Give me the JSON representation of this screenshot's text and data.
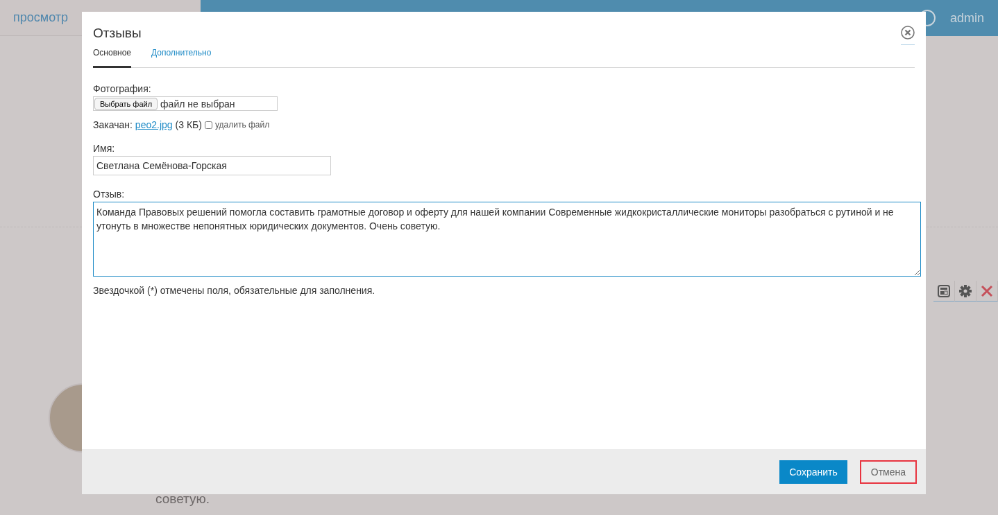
{
  "header": {
    "link": "просмотр",
    "user": "admin"
  },
  "background_review": {
    "text_tail": "советую."
  },
  "modal": {
    "title": "Отзывы",
    "tabs": [
      {
        "label": "Основное",
        "selected": true
      },
      {
        "label": "Дополнительно",
        "selected": false
      }
    ],
    "photo": {
      "label": "Фотография:",
      "button": "Выбрать файл",
      "status": "файл не выбран",
      "uploaded_label": "Закачан:",
      "file_link": "peo2.jpg",
      "file_size": "(3 КБ)",
      "delete": {
        "label": "удалить файл",
        "checked": false
      }
    },
    "name": {
      "label": "Имя:",
      "value": "Светлана Семёнова-Горская"
    },
    "review": {
      "label": "Отзыв:",
      "value": "Команда Правовых решений помогла составить грамотные договор и оферту для нашей компании Современные жидкокристаллические мониторы разобраться с рутиной и не утонуть в множестве непонятных юридических документов. Очень советую.",
      "focused": true
    },
    "note": "Звездочкой (*) отмечены поля, обязательные для заполнения.",
    "buttons": [
      {
        "label": "Сохранить",
        "kind": "primary"
      },
      {
        "label": "Отмена",
        "kind": "secondary"
      }
    ]
  }
}
